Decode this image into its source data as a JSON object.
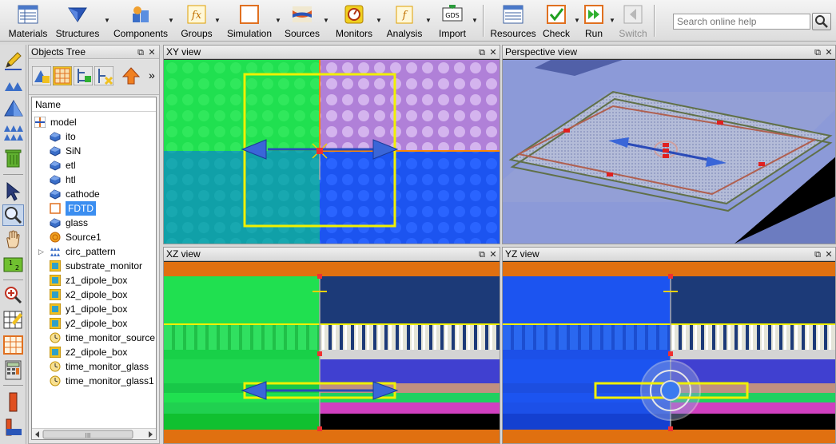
{
  "toolbar": {
    "materials": "Materials",
    "structures": "Structures",
    "components": "Components",
    "groups": "Groups",
    "simulation": "Simulation",
    "sources": "Sources",
    "monitors": "Monitors",
    "analysis": "Analysis",
    "import": "Import",
    "resources": "Resources",
    "check": "Check",
    "run": "Run",
    "switch": "Switch",
    "search_placeholder": "Search online help",
    "import_icon_text": "GDS",
    "groups_icon_text": "fx"
  },
  "tree": {
    "title": "Objects Tree",
    "column": "Name",
    "items": [
      {
        "label": "model",
        "icon": "model-icon"
      },
      {
        "label": "ito",
        "icon": "structure-icon"
      },
      {
        "label": "SiN",
        "icon": "structure-icon"
      },
      {
        "label": "etl",
        "icon": "structure-icon"
      },
      {
        "label": "htl",
        "icon": "structure-icon"
      },
      {
        "label": "cathode",
        "icon": "structure-icon"
      },
      {
        "label": "FDTD",
        "icon": "fdtd-icon"
      },
      {
        "label": "glass",
        "icon": "structure-icon"
      },
      {
        "label": "Source1",
        "icon": "source-icon"
      },
      {
        "label": "circ_pattern",
        "icon": "pattern-icon"
      },
      {
        "label": "substrate_monitor",
        "icon": "monitor-icon"
      },
      {
        "label": "z1_dipole_box",
        "icon": "monitor-icon"
      },
      {
        "label": "x2_dipole_box",
        "icon": "monitor-icon"
      },
      {
        "label": "y1_dipole_box",
        "icon": "monitor-icon"
      },
      {
        "label": "y2_dipole_box",
        "icon": "monitor-icon"
      },
      {
        "label": "time_monitor_source",
        "icon": "time-monitor-icon"
      },
      {
        "label": "z2_dipole_box",
        "icon": "monitor-icon"
      },
      {
        "label": "time_monitor_glass",
        "icon": "time-monitor-icon"
      },
      {
        "label": "time_monitor_glass1",
        "icon": "time-monitor-icon"
      }
    ],
    "selected": "FDTD",
    "scroll_grip": "III"
  },
  "views": {
    "xy": "XY view",
    "perspective": "Perspective view",
    "xz": "XZ view",
    "yz": "YZ view"
  },
  "panel_buttons": {
    "float": "⧉",
    "close": "✕"
  },
  "more_glyph": "»",
  "colors": {
    "fdtd_yellow": "#f0f000",
    "orange": "#ff8800",
    "green": "#20e050",
    "blue": "#1c54f0",
    "purple": "#b080d8",
    "teal": "#10a0a8",
    "navy": "#1c3a78",
    "selection": "#3b8ef0"
  }
}
